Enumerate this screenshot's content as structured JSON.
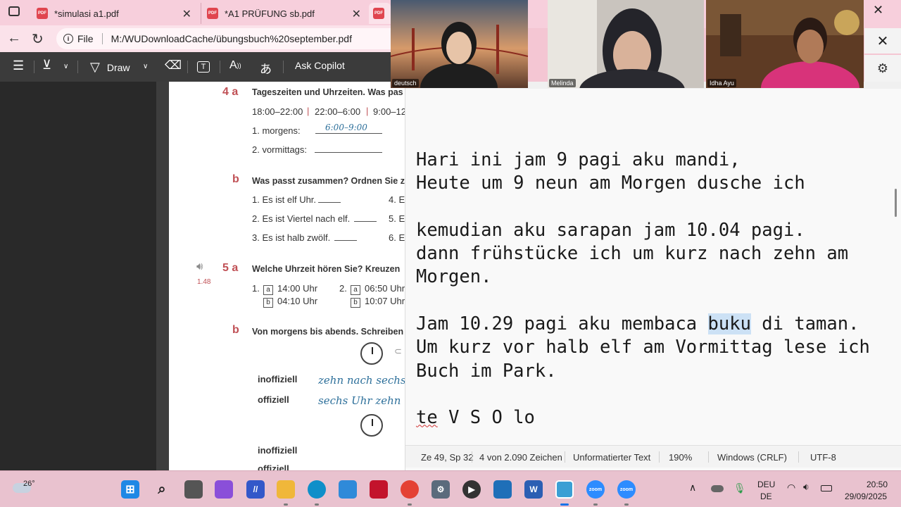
{
  "browser": {
    "tabs": [
      {
        "label": "*simulasi a1.pdf"
      },
      {
        "label": "*A1 PRÜFUNG sb.pdf"
      }
    ],
    "url_prefix": "File",
    "url": "M:/WUDownloadCache/übungsbuch%20september.pdf",
    "toolbar": {
      "draw_label": "Draw",
      "copilot_label": "Ask Copilot"
    }
  },
  "pdf": {
    "sec4a_num": "4 a",
    "sec4a_title": "Tageszeiten und Uhrzeiten. Was pas",
    "times": [
      "18:00–22:00",
      "22:00–6:00",
      "9:00–12"
    ],
    "sep": "|",
    "item1_label": "1. morgens:",
    "item1_answer": "6:00–9:00",
    "item2_label": "2. vormittags:",
    "sec4b_num": "b",
    "sec4b_title": "Was passt zusammen? Ordnen Sie z",
    "b_items": [
      "1. Es ist elf Uhr.",
      "2. Es ist Viertel nach elf.",
      "3. Es ist halb zwölf."
    ],
    "b_right": [
      "4. E",
      "5. E",
      "6. E"
    ],
    "audio_track": "1.48",
    "sec5a_num": "5 a",
    "sec5a_title": "Welche Uhrzeit hören Sie? Kreuzen",
    "opt_1": "1.",
    "opt_2": "2.",
    "opt_a": "a",
    "opt_b": "b",
    "q1a": "14:00 Uhr",
    "q1b": "04:10 Uhr",
    "q2a": "06:50 Uhr",
    "q2b": "10:07 Uhr",
    "sec5b_num": "b",
    "sec5b_title": "Von morgens bis abends. Schreiben",
    "inoffiziell": "inoffiziell",
    "offiziell": "offiziell",
    "hand1": "zehn nach sechs",
    "hand2": "sechs Uhr zehn"
  },
  "notepad": {
    "lines": [
      "Hari ini jam 9 pagi aku mandi,",
      "Heute um 9 neun am Morgen dusche ich",
      "",
      "kemudian aku sarapan jam 10.04 pagi.",
      "dann frühstücke ich um kurz nach zehn am",
      "Morgen.",
      "",
      "Um kurz vor halb elf am Vormittag lese ich",
      "Buch im Park.",
      ""
    ],
    "line8_before": "Jam 10.29 pagi aku membaca ",
    "line8_selected": "buku",
    "line8_after": " di taman.",
    "last_line_misspelled": "te",
    "last_line_rest": " V S O lo",
    "status": {
      "position": "Ze 49, Sp 32",
      "count": "4 von 2.090 Zeichen",
      "format": "Unformatierter Text",
      "zoom": "190%",
      "eol": "Windows (CRLF)",
      "encoding": "UTF-8"
    }
  },
  "video": {
    "participants": [
      {
        "name": "deutsch"
      },
      {
        "name": "Melinda"
      },
      {
        "name": "Idha Ayu"
      }
    ]
  },
  "taskbar": {
    "weather": "26°",
    "lang_top": "DEU",
    "lang_bottom": "DE",
    "time": "20:50",
    "date": "29/09/2025",
    "word_letter": "W"
  },
  "colors": {
    "accent_pink": "#f4c6d3",
    "selection": "#cce1f5",
    "section_red": "#c05055",
    "handwriting_blue": "#2c6f9a"
  }
}
